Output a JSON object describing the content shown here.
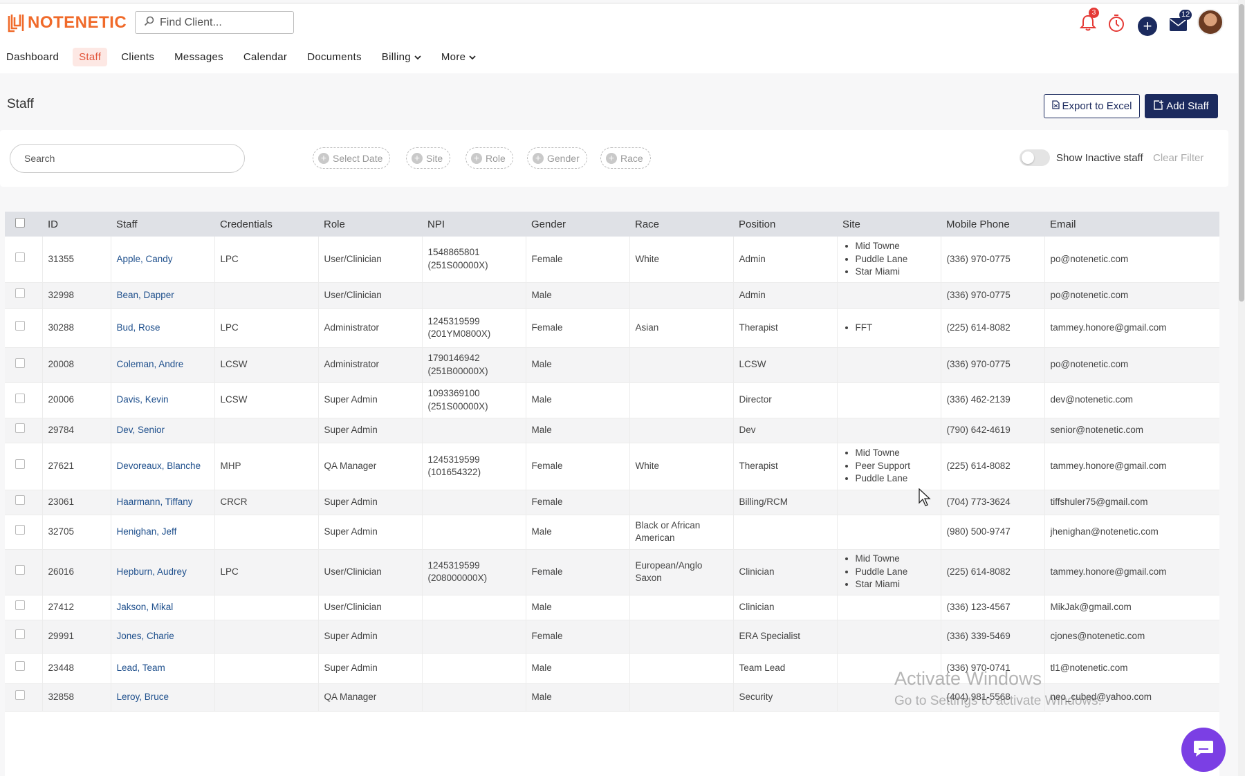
{
  "brand": {
    "logo_text": "NOTENETIC",
    "accent": "#f06a2a",
    "navy": "#1b2a5e"
  },
  "header": {
    "find_client_placeholder": "Find Client...",
    "notification_badge": "3",
    "mail_badge": "12",
    "icons": [
      "bell-icon",
      "timer-icon",
      "plus-icon",
      "mail-icon",
      "avatar"
    ]
  },
  "nav": {
    "items": [
      {
        "label": "Dashboard"
      },
      {
        "label": "Staff"
      },
      {
        "label": "Clients"
      },
      {
        "label": "Messages"
      },
      {
        "label": "Calendar"
      },
      {
        "label": "Documents"
      },
      {
        "label": "Billing"
      },
      {
        "label": "More"
      }
    ],
    "active": "Staff"
  },
  "page": {
    "title": "Staff",
    "export_label": "Export to Excel",
    "add_label": "Add Staff"
  },
  "filters": {
    "search_placeholder": "Search",
    "chips": [
      "Select Date",
      "Site",
      "Role",
      "Gender",
      "Race"
    ],
    "toggle_label": "Show Inactive staff",
    "toggle_on": false,
    "clear_label": "Clear Filter"
  },
  "table": {
    "columns": [
      "ID",
      "Staff",
      "Credentials",
      "Role",
      "NPI",
      "Gender",
      "Race",
      "Position",
      "Site",
      "Mobile Phone",
      "Email"
    ],
    "rows": [
      {
        "id": "31355",
        "staff": "Apple, Candy",
        "cred": "LPC",
        "role": "User/Clinician",
        "npi": [
          "1548865801",
          "(251S00000X)"
        ],
        "gender": "Female",
        "race": [
          "White"
        ],
        "position": "Admin",
        "sites": [
          "Mid Towne",
          "Puddle Lane",
          "Star Miami"
        ],
        "phone": "(336) 970-0775",
        "email": "po@notenetic.com"
      },
      {
        "id": "32998",
        "staff": "Bean, Dapper",
        "cred": "",
        "role": "User/Clinician",
        "npi": [],
        "gender": "Male",
        "race": [],
        "position": "Admin",
        "sites": [],
        "phone": "(336) 970-0775",
        "email": "po@notenetic.com"
      },
      {
        "id": "30288",
        "staff": "Bud, Rose",
        "cred": "LPC",
        "role": "Administrator",
        "npi": [
          "1245319599",
          "(201YM0800X)"
        ],
        "gender": "Female",
        "race": [
          "Asian"
        ],
        "position": "Therapist",
        "sites": [
          "FFT"
        ],
        "phone": "(225) 614-8082",
        "email": "tammey.honore@gmail.com"
      },
      {
        "id": "20008",
        "staff": "Coleman, Andre",
        "cred": "LCSW",
        "role": "Administrator",
        "npi": [
          "1790146942",
          "(251B00000X)"
        ],
        "gender": "Male",
        "race": [],
        "position": "LCSW",
        "sites": [],
        "phone": "(336) 970-0775",
        "email": "po@notenetic.com"
      },
      {
        "id": "20006",
        "staff": "Davis, Kevin",
        "cred": "LCSW",
        "role": "Super Admin",
        "npi": [
          "1093369100",
          "(251S00000X)"
        ],
        "gender": "Male",
        "race": [],
        "position": "Director",
        "sites": [],
        "phone": "(336) 462-2139",
        "email": "dev@notenetic.com"
      },
      {
        "id": "29784",
        "staff": "Dev, Senior",
        "cred": "",
        "role": "Super Admin",
        "npi": [],
        "gender": "Male",
        "race": [],
        "position": "Dev",
        "sites": [],
        "phone": "(790) 642-4619",
        "email": "senior@notenetic.com"
      },
      {
        "id": "27621",
        "staff": "Devoreaux, Blanche",
        "cred": "MHP",
        "role": "QA Manager",
        "npi": [
          "1245319599",
          "(101654322)"
        ],
        "gender": "Female",
        "race": [
          "White"
        ],
        "position": "Therapist",
        "sites": [
          "Mid Towne",
          "Peer Support",
          "Puddle Lane"
        ],
        "phone": "(225) 614-8082",
        "email": "tammey.honore@gmail.com"
      },
      {
        "id": "23061",
        "staff": "Haarmann, Tiffany",
        "cred": "CRCR",
        "role": "Super Admin",
        "npi": [],
        "gender": "Female",
        "race": [],
        "position": "Billing/RCM",
        "sites": [],
        "phone": "(704) 773-3624",
        "email": "tiffshuler75@gmail.com"
      },
      {
        "id": "32705",
        "staff": "Henighan, Jeff",
        "cred": "",
        "role": "Super Admin",
        "npi": [],
        "gender": "Male",
        "race": [
          "Black or African",
          "American"
        ],
        "position": "",
        "sites": [],
        "phone": "(980) 500-9747",
        "email": "jhenighan@notenetic.com"
      },
      {
        "id": "26016",
        "staff": "Hepburn, Audrey",
        "cred": "LPC",
        "role": "User/Clinician",
        "npi": [
          "1245319599",
          "(208000000X)"
        ],
        "gender": "Female",
        "race": [
          "European/Anglo",
          "Saxon"
        ],
        "position": "Clinician",
        "sites": [
          "Mid Towne",
          "Puddle Lane",
          "Star Miami"
        ],
        "phone": "(225) 614-8082",
        "email": "tammey.honore@gmail.com"
      },
      {
        "id": "27412",
        "staff": "Jakson, Mikal",
        "cred": "",
        "role": "User/Clinician",
        "npi": [],
        "gender": "Male",
        "race": [],
        "position": "Clinician",
        "sites": [],
        "phone": "(336) 123-4567",
        "email": "MikJak@gmail.com"
      },
      {
        "id": "29991",
        "staff": "Jones, Charie",
        "cred": "",
        "role": "Super Admin",
        "npi": [],
        "gender": "Female",
        "race": [],
        "position": "ERA Specialist",
        "sites": [],
        "phone": "(336) 339-5469",
        "email": "cjones@notenetic.com"
      },
      {
        "id": "23448",
        "staff": "Lead, Team",
        "cred": "",
        "role": "Super Admin",
        "npi": [],
        "gender": "Male",
        "race": [],
        "position": "Team Lead",
        "sites": [],
        "phone": "(336) 970-0741",
        "email": "tl1@notenetic.com"
      },
      {
        "id": "32858",
        "staff": "Leroy, Bruce",
        "cred": "",
        "role": "QA Manager",
        "npi": [],
        "gender": "Male",
        "race": [],
        "position": "Security",
        "sites": [],
        "phone": "(404) 981-5568",
        "email": "neo_cubed@yahoo.com"
      }
    ]
  },
  "watermark": {
    "line1": "Activate Windows",
    "line2": "Go to Settings to activate Windows."
  }
}
